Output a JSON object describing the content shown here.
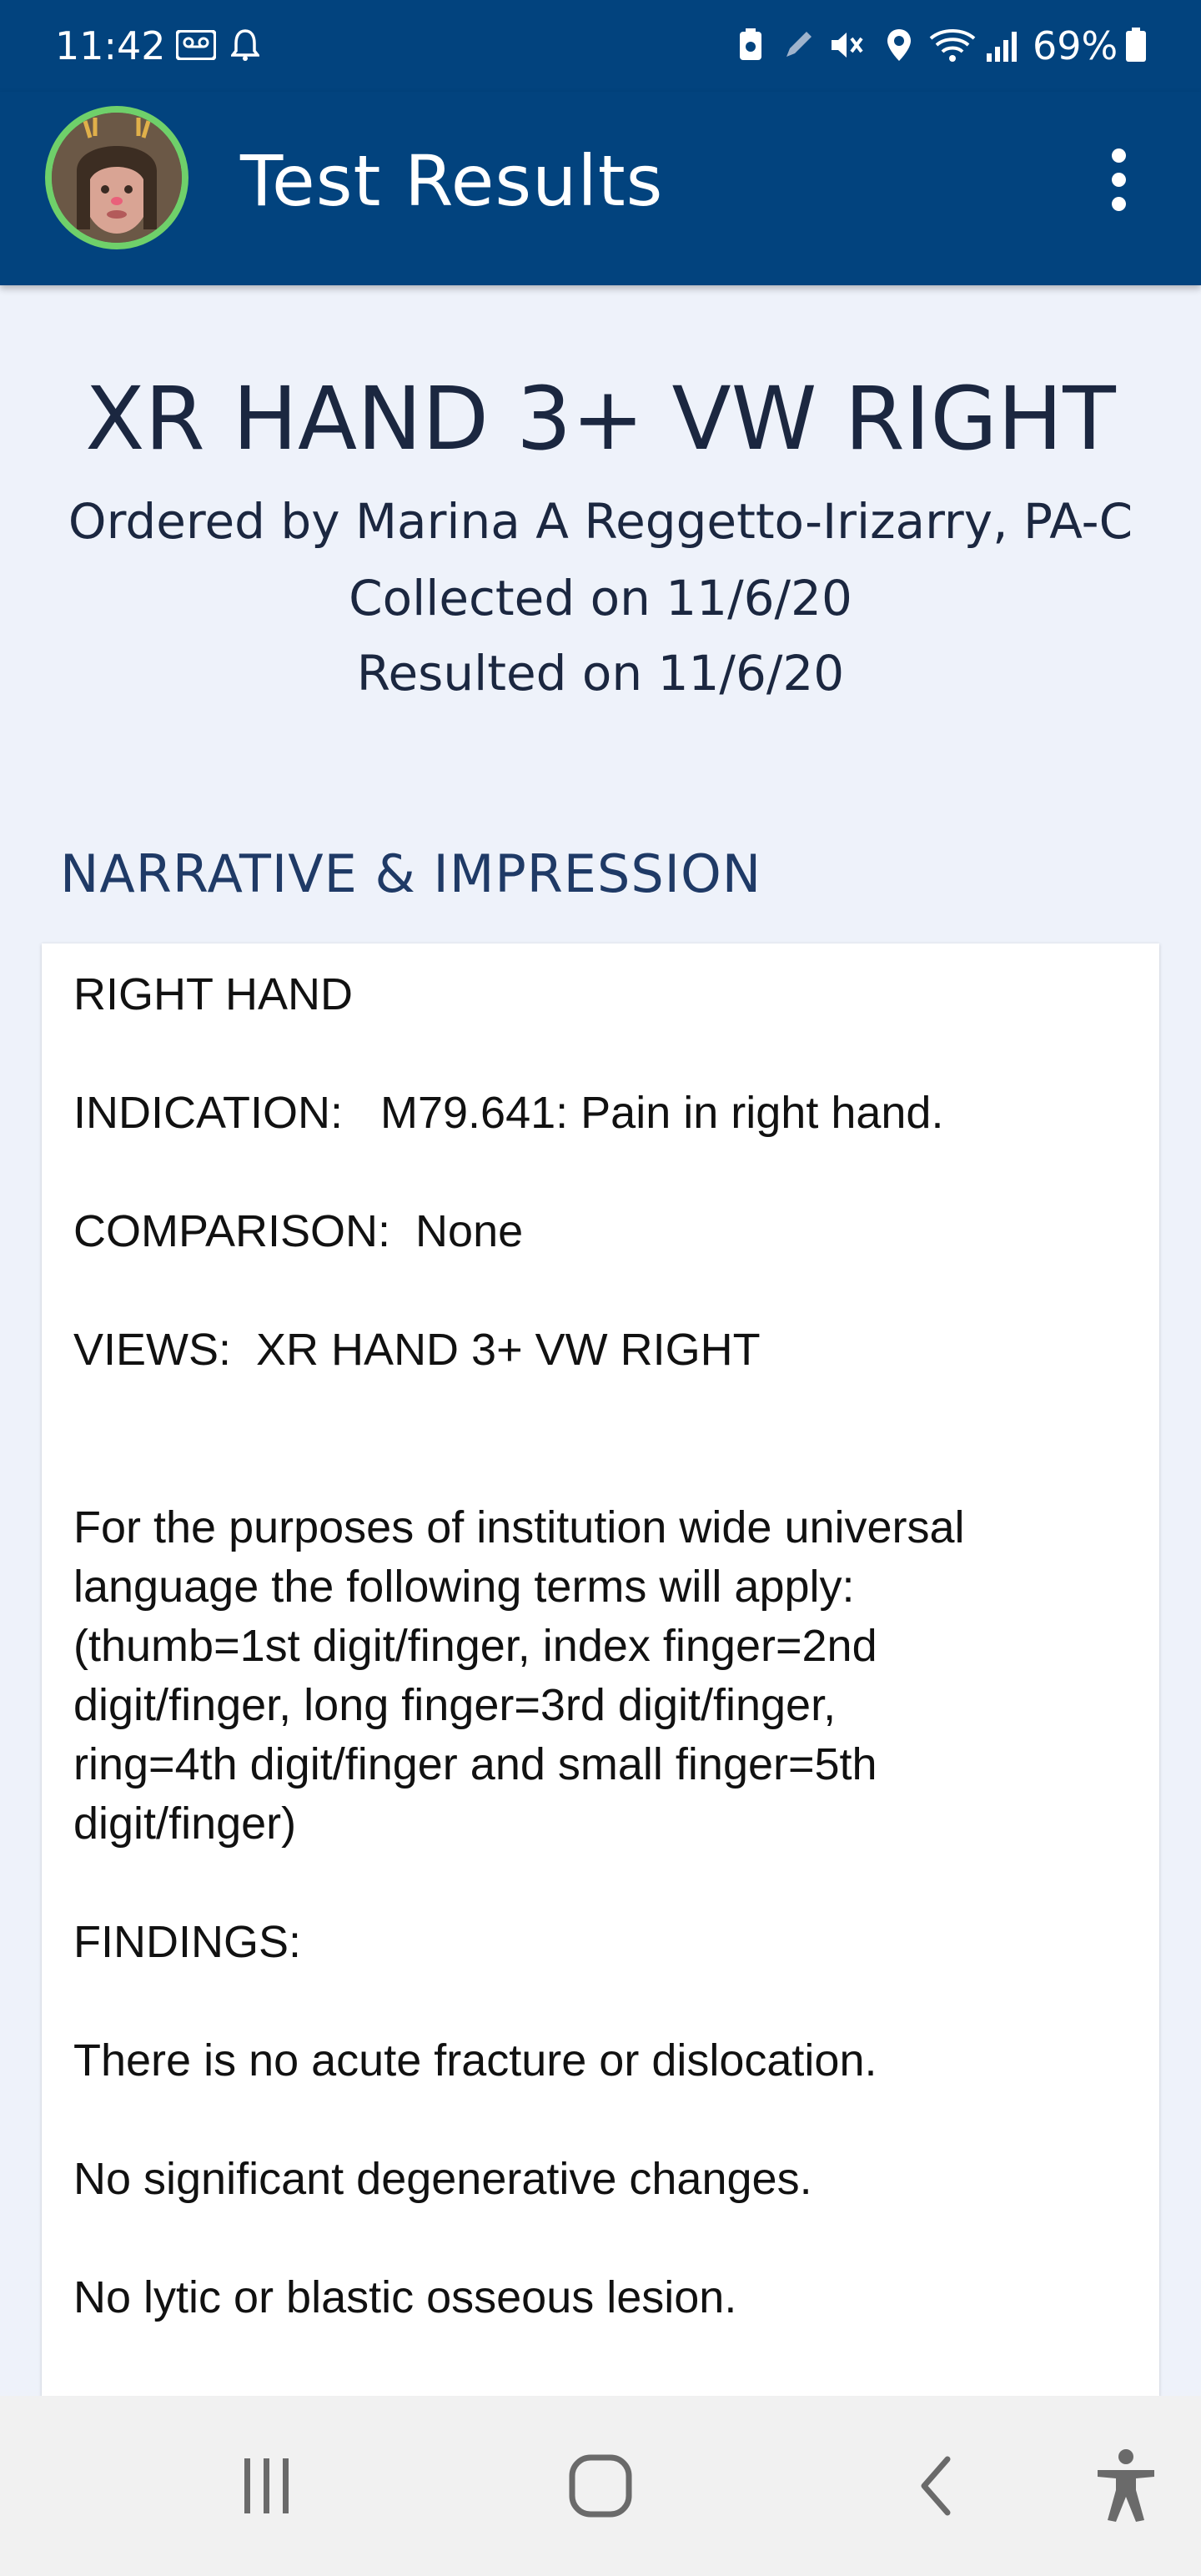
{
  "status_bar": {
    "time": "11:42",
    "battery_percent": "69%",
    "icons": [
      "voicemail-icon",
      "alarm-icon",
      "save-icon",
      "pen-icon",
      "mute-icon",
      "location-icon",
      "wifi-icon",
      "signal-icon",
      "battery-icon"
    ]
  },
  "app_bar": {
    "title": "Test Results",
    "menu_icon": "more-vert-icon",
    "accent_color": "#02437e",
    "avatar_border_color": "#6fd06a"
  },
  "header": {
    "test_name": "XR HAND 3+ VW RIGHT",
    "ordered_by": "Ordered by Marina A Reggetto-Irizarry, PA-C",
    "collected_on": "Collected on 11/6/20",
    "resulted_on": "Resulted on 11/6/20"
  },
  "section": {
    "heading": "NARRATIVE & IMPRESSION"
  },
  "report": {
    "title": "RIGHT HAND",
    "indication": "INDICATION:   M79.641: Pain in right hand.",
    "comparison": "COMPARISON:  None",
    "views": "VIEWS:  XR HAND 3+ VW RIGHT",
    "universal_language": [
      "For the purposes of institution wide universal",
      "language the following terms will apply:",
      "(thumb=1st digit/finger, index finger=2nd",
      "digit/finger, long finger=3rd digit/finger,",
      "ring=4th digit/finger and small finger=5th",
      "digit/finger)"
    ],
    "findings_label": "FINDINGS:",
    "findings": [
      "There is no acute fracture or dislocation.",
      "No significant degenerative changes.",
      "No lytic or blastic osseous lesion."
    ]
  },
  "nav_bar": {
    "buttons": [
      "recent-apps-icon",
      "home-icon",
      "back-icon",
      "accessibility-icon"
    ]
  }
}
